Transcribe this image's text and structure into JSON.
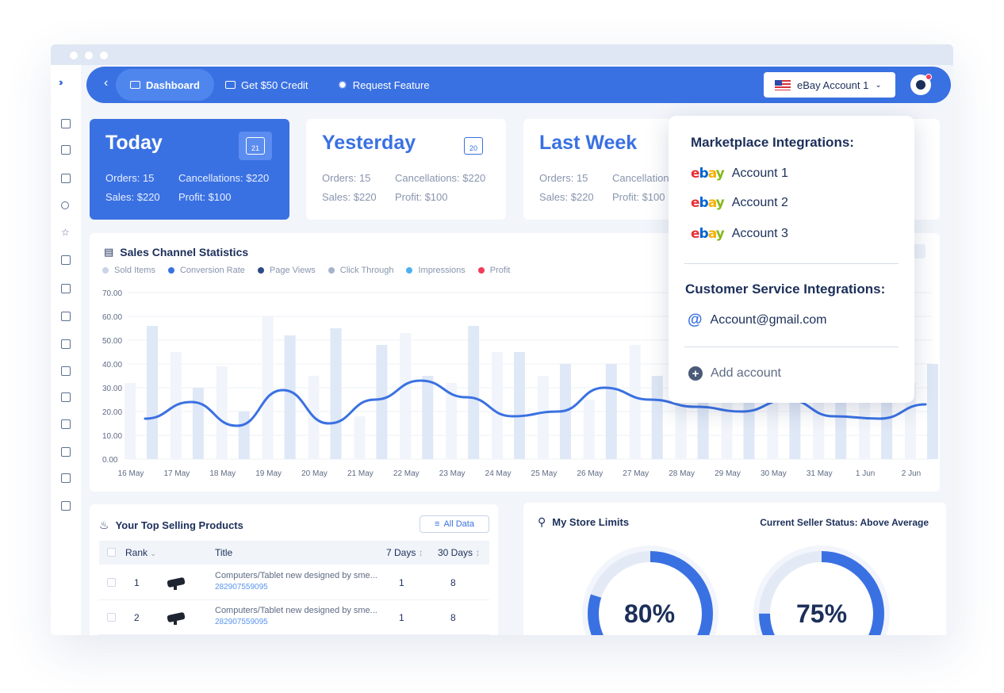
{
  "nav": {
    "tabs": [
      {
        "label": "Dashboard",
        "active": true
      },
      {
        "label": "Get $50 Credit"
      },
      {
        "label": "Request Feature"
      }
    ],
    "account_select": "eBay Account 1"
  },
  "stats": [
    {
      "title": "Today",
      "calendar_day": "21",
      "orders": "Orders: 15",
      "cancellations": "Cancellations: $220",
      "sales": "Sales: $220",
      "profit": "Profit: $100"
    },
    {
      "title": "Yesterday",
      "calendar_day": "20",
      "orders": "Orders: 15",
      "cancellations": "Cancellations: $220",
      "sales": "Sales: $220",
      "profit": "Profit: $100"
    },
    {
      "title": "Last Week",
      "orders": "Orders: 15",
      "cancellations": "Cancellation",
      "sales": "Sales: $220",
      "profit": "Profit: $100"
    }
  ],
  "chart_data": {
    "type": "bar",
    "title": "Sales Channel Statistics",
    "legend": [
      {
        "name": "Sold Items",
        "color": "#c9d4e6"
      },
      {
        "name": "Conversion Rate",
        "color": "#3a71e2"
      },
      {
        "name": "Page Views",
        "color": "#2c4a86"
      },
      {
        "name": "Click Through",
        "color": "#a7b3c9"
      },
      {
        "name": "Impressions",
        "color": "#4fb1ef"
      },
      {
        "name": "Profit",
        "color": "#ef3c5a"
      }
    ],
    "y_ticks": [
      "70.00",
      "60.00",
      "50.00",
      "40.00",
      "30.00",
      "20.00",
      "10.00",
      "0.00"
    ],
    "ylim": [
      0,
      70
    ],
    "categories": [
      "16 May",
      "17 May",
      "18 May",
      "19 May",
      "20 May",
      "21 May",
      "22 May",
      "23 May",
      "24 May",
      "25 May",
      "26 May",
      "27 May",
      "28 May",
      "29 May",
      "30 May",
      "31 May",
      "1 Jun",
      "2 Jun"
    ],
    "series": [
      {
        "values": [
          32,
          45,
          39,
          60,
          35,
          18,
          53,
          32,
          45,
          35,
          25,
          48,
          40,
          42,
          38,
          30,
          55,
          32
        ]
      },
      {
        "values": [
          56,
          30,
          20,
          52,
          55,
          48,
          35,
          56,
          45,
          40,
          40,
          35,
          45,
          48,
          45,
          25,
          45,
          40
        ]
      },
      {
        "values": [
          17,
          24,
          14,
          29,
          15,
          25,
          33,
          26,
          18,
          20,
          30,
          25,
          22,
          20,
          25,
          18,
          17,
          23
        ]
      }
    ]
  },
  "top_products": {
    "title": "Your Top Selling Products",
    "all_data_label": "All Data",
    "headers": {
      "rank": "Rank",
      "title": "Title",
      "d7": "7 Days",
      "d30": "30 Days"
    },
    "rows": [
      {
        "rank": "1",
        "title": "Computers/Tablet new designed by sme...",
        "id": "282907559095",
        "d7": "1",
        "d30": "8"
      },
      {
        "rank": "2",
        "title": "Computers/Tablet new designed by sme...",
        "id": "282907559095",
        "d7": "1",
        "d30": "8"
      }
    ]
  },
  "store_limits": {
    "title": "My Store Limits",
    "seller_status": "Current Seller Status: Above Average",
    "gauges": [
      {
        "label": "80%",
        "value": 0.8
      },
      {
        "label": "75%",
        "value": 0.75
      }
    ]
  },
  "dropdown": {
    "marketplace_heading": "Marketplace Integrations:",
    "marketplace_accounts": [
      "Account 1",
      "Account 2",
      "Account 3"
    ],
    "cs_heading": "Customer Service Integrations:",
    "cs_account": "Account@gmail.com",
    "add_account": "Add account"
  },
  "colors": {
    "primary": "#3a71e2",
    "dark_text": "#1c2f5a",
    "muted_text": "#8895ad"
  }
}
